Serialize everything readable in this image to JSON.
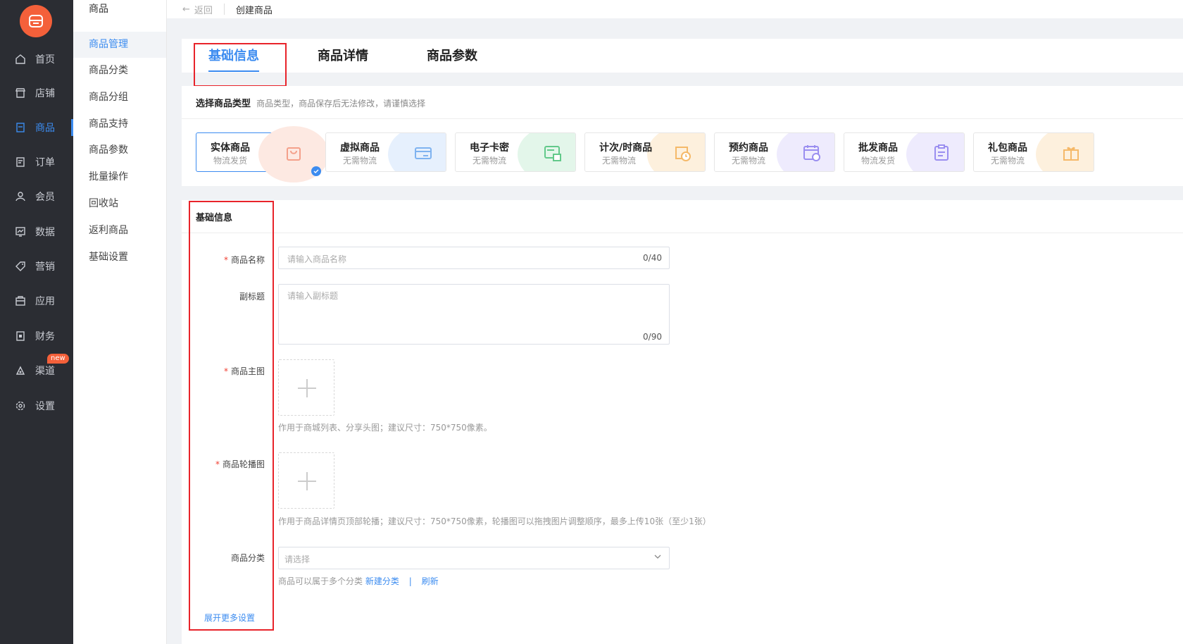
{
  "nav": {
    "items": [
      {
        "label": "首页",
        "icon": "home-icon"
      },
      {
        "label": "店铺",
        "icon": "shop-icon"
      },
      {
        "label": "商品",
        "icon": "goods-icon"
      },
      {
        "label": "订单",
        "icon": "order-icon"
      },
      {
        "label": "会员",
        "icon": "member-icon"
      },
      {
        "label": "数据",
        "icon": "data-icon"
      },
      {
        "label": "营销",
        "icon": "tag-icon"
      },
      {
        "label": "应用",
        "icon": "app-icon"
      },
      {
        "label": "财务",
        "icon": "finance-icon"
      },
      {
        "label": "渠道",
        "icon": "channel-icon"
      },
      {
        "label": "设置",
        "icon": "gear-icon"
      }
    ],
    "new_badge": "new"
  },
  "submenu": {
    "title": "商品",
    "items": [
      "商品管理",
      "商品分类",
      "商品分组",
      "商品支持",
      "商品参数",
      "批量操作",
      "回收站",
      "返利商品",
      "基础设置"
    ]
  },
  "topbar": {
    "back": "返回",
    "crumb": "创建商品"
  },
  "tabs": [
    "基础信息",
    "商品详情",
    "商品参数"
  ],
  "type_section": {
    "title": "选择商品类型",
    "hint": "商品类型，商品保存后无法修改，请谨慎选择",
    "types": [
      {
        "name": "实体商品",
        "desc": "物流发货",
        "color": "#f4a08a",
        "blob": "#fde9e2"
      },
      {
        "name": "虚拟商品",
        "desc": "无需物流",
        "color": "#7fb3f0",
        "blob": "#e6f0fd"
      },
      {
        "name": "电子卡密",
        "desc": "无需物流",
        "color": "#62c98a",
        "blob": "#e3f6ea"
      },
      {
        "name": "计次/时商品",
        "desc": "无需物流",
        "color": "#f5b969",
        "blob": "#fdf0dd"
      },
      {
        "name": "预约商品",
        "desc": "无需物流",
        "color": "#9a8ef0",
        "blob": "#eeebfd"
      },
      {
        "name": "批发商品",
        "desc": "物流发货",
        "color": "#9a8ef0",
        "blob": "#eeebfd"
      },
      {
        "name": "礼包商品",
        "desc": "无需物流",
        "color": "#f5b969",
        "blob": "#fdf0dd"
      }
    ]
  },
  "form": {
    "title": "基础信息",
    "name_label": "商品名称",
    "name_placeholder": "请输入商品名称",
    "name_count": "0/40",
    "subtitle_label": "副标题",
    "subtitle_placeholder": "请输入副标题",
    "subtitle_count": "0/90",
    "main_img_label": "商品主图",
    "main_img_hint": "作用于商城列表、分享头图；建议尺寸：750*750像素。",
    "carousel_label": "商品轮播图",
    "carousel_hint": "作用于商品详情页顶部轮播；建议尺寸：750*750像素，轮播图可以拖拽图片调整顺序，最多上传10张（至少1张）",
    "category_label": "商品分类",
    "category_placeholder": "请选择",
    "category_hint": "商品可以属于多个分类",
    "new_category": "新建分类",
    "divider": "|",
    "refresh": "刷新",
    "expand_more": "展开更多设置"
  },
  "colors": {
    "accent": "#3c8cf0",
    "nav_bg": "#2b2d33",
    "logo": "#f4603a",
    "annotation": "#e8232a"
  }
}
